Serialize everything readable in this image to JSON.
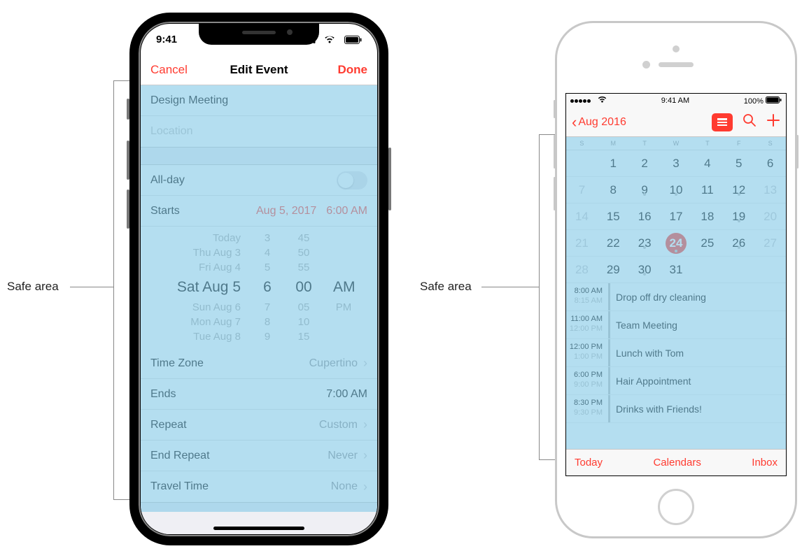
{
  "labels": {
    "safe_area_1": "Safe area",
    "safe_area_2": "Safe area"
  },
  "phone_x": {
    "statusbar": {
      "time": "9:41"
    },
    "navbar": {
      "cancel": "Cancel",
      "title": "Edit Event",
      "done": "Done"
    },
    "group1": {
      "title_value": "Design Meeting",
      "location_placeholder": "Location"
    },
    "group2": {
      "allday_label": "All-day",
      "starts_label": "Starts",
      "starts_date": "Aug 5, 2017",
      "starts_time": "6:00 AM",
      "picker": [
        {
          "d": "Today",
          "h": "3",
          "m": "45",
          "a": ""
        },
        {
          "d": "Thu Aug 3",
          "h": "4",
          "m": "50",
          "a": ""
        },
        {
          "d": "Fri Aug 4",
          "h": "5",
          "m": "55",
          "a": ""
        },
        {
          "d": "Sat Aug 5",
          "h": "6",
          "m": "00",
          "a": "AM"
        },
        {
          "d": "Sun Aug 6",
          "h": "7",
          "m": "05",
          "a": "PM"
        },
        {
          "d": "Mon Aug 7",
          "h": "8",
          "m": "10",
          "a": ""
        },
        {
          "d": "Tue Aug 8",
          "h": "9",
          "m": "15",
          "a": ""
        }
      ],
      "timezone_label": "Time Zone",
      "timezone_value": "Cupertino",
      "ends_label": "Ends",
      "ends_value": "7:00 AM",
      "repeat_label": "Repeat",
      "repeat_value": "Custom",
      "endrepeat_label": "End Repeat",
      "endrepeat_value": "Never",
      "travel_label": "Travel Time",
      "travel_value": "None"
    }
  },
  "phone_8": {
    "statusbar": {
      "time": "9:41 AM",
      "battery": "100%"
    },
    "navbar": {
      "back": "Aug 2016"
    },
    "weekdays": [
      "S",
      "M",
      "T",
      "W",
      "T",
      "F",
      "S"
    ],
    "month": [
      [
        "",
        "1",
        "2",
        "3",
        "4",
        "5",
        "6"
      ],
      [
        "7",
        "8",
        "9",
        "10",
        "11",
        "12",
        "13"
      ],
      [
        "14",
        "15",
        "16",
        "17",
        "18",
        "19",
        "20"
      ],
      [
        "21",
        "22",
        "23",
        "24",
        "25",
        "26",
        "27"
      ],
      [
        "28",
        "29",
        "30",
        "31",
        "",
        "",
        ""
      ]
    ],
    "month_dim": {
      "r0": [
        0
      ],
      "r1": [
        0,
        6
      ],
      "r2": [
        0,
        6
      ],
      "r3": [
        0,
        6
      ],
      "r4": [
        0
      ]
    },
    "month_dots": {
      "r1": [
        2,
        3,
        5
      ],
      "r2": [
        5
      ],
      "r3": [
        2,
        3,
        5
      ],
      "r4": [
        2
      ]
    },
    "selected": {
      "row": 3,
      "col": 3
    },
    "agenda": [
      {
        "t1": "8:00 AM",
        "t2": "8:15 AM",
        "title": "Drop off dry cleaning"
      },
      {
        "t1": "11:00 AM",
        "t2": "12:00 PM",
        "title": "Team Meeting"
      },
      {
        "t1": "12:00 PM",
        "t2": "1:00 PM",
        "title": "Lunch with Tom"
      },
      {
        "t1": "6:00 PM",
        "t2": "9:00 PM",
        "title": "Hair Appointment"
      },
      {
        "t1": "8:30 PM",
        "t2": "9:30 PM",
        "title": "Drinks with Friends!"
      }
    ],
    "toolbar": {
      "today": "Today",
      "calendars": "Calendars",
      "inbox": "Inbox"
    }
  }
}
